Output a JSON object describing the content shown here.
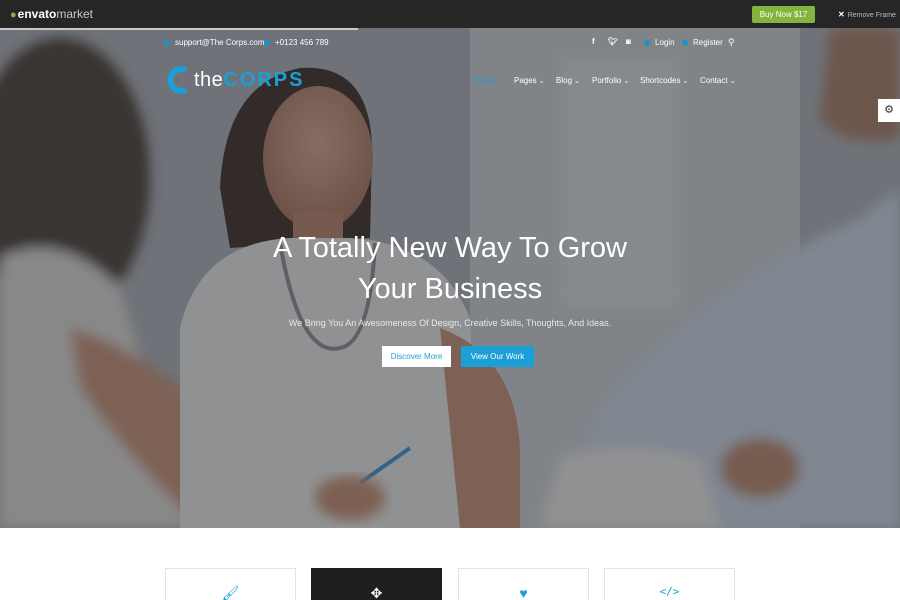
{
  "envato": {
    "logo_main": "envato",
    "logo_market": "market",
    "buy_label": "Buy Now $17",
    "remove_label": "Remove Frame",
    "colors": {
      "bar": "#262626",
      "accent": "#82b440"
    }
  },
  "topbar": {
    "email": "support@The Corps.com",
    "phone": "+0123 456 789",
    "social_icons": [
      "facebook-icon",
      "twitter-icon",
      "instagram-icon"
    ],
    "login_label": "Login",
    "register_label": "Register"
  },
  "logo": {
    "the": "the",
    "corps": "CORPS"
  },
  "nav": {
    "items": [
      {
        "label": "Home",
        "active": true
      },
      {
        "label": "Pages",
        "dropdown": true
      },
      {
        "label": "Blog",
        "dropdown": true
      },
      {
        "label": "Portfolio",
        "dropdown": true
      },
      {
        "label": "Shortcodes",
        "dropdown": true
      },
      {
        "label": "Contact",
        "dropdown": true
      }
    ]
  },
  "hero": {
    "headline_line1": "A Totally New Way To Grow",
    "headline_line2": "Your Business",
    "subline": "We Bring You An Awesomeness Of Design, Creative Skills, Thoughts, And Ideas.",
    "btn_discover": "Discover More",
    "btn_work": "View Our Work"
  },
  "features": [
    {
      "icon": "paintbrush-icon"
    },
    {
      "icon": "move-arrows-icon"
    },
    {
      "icon": "heart-icon"
    },
    {
      "icon": "code-icon"
    }
  ],
  "colors": {
    "accent": "#1a9fd6",
    "overlay": "#282c34"
  }
}
